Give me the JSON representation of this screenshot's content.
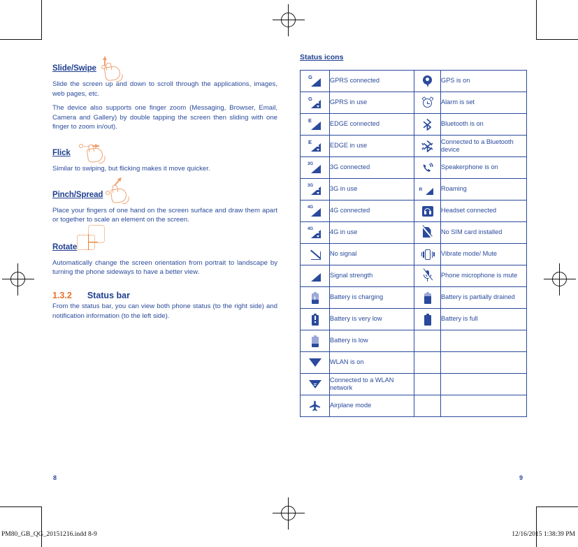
{
  "document": {
    "left_page_number": "8",
    "right_page_number": "9",
    "footer_left": "PM80_GB_QG_20151216.indd   8-9",
    "footer_right": "12/16/2015   1:38:39 PM"
  },
  "colors": {
    "body_blue": "#2a4a9c",
    "heading_blue": "#1f3f8f",
    "accent_orange": "#e8712a",
    "pictogram_orange": "#f0a070"
  },
  "gestures": [
    {
      "id": "slide-swipe",
      "heading": "Slide/Swipe",
      "icon": "hand-swipe-icon",
      "paragraphs": [
        "Slide the screen up and down to scroll through the applications, images, web pages, etc.",
        "The device also supports one finger zoom (Messaging, Browser, Email, Camera and Gallery) by double tapping the screen then sliding with one finger to zoom in/out)."
      ]
    },
    {
      "id": "flick",
      "heading": "Flick",
      "icon": "hand-flick-icon",
      "paragraphs": [
        "Similar to swiping, but flicking makes it move quicker."
      ]
    },
    {
      "id": "pinch-spread",
      "heading": "Pinch/Spread",
      "icon": "hand-pinch-icon",
      "paragraphs": [
        "Place your fingers of one hand on the screen surface and draw them apart or together to scale an element on the screen."
      ]
    },
    {
      "id": "rotate",
      "heading": "Rotate",
      "icon": "device-rotate-icon",
      "paragraphs": [
        "Automatically change the screen orientation from portrait to landscape by turning the phone sideways to have a better view."
      ]
    }
  ],
  "section": {
    "number": "1.3.2",
    "title": "Status bar",
    "body": "From the status bar, you can view both phone status (to the right side) and notification information (to the left side)."
  },
  "status_icons": {
    "heading": "Status icons",
    "rows": [
      {
        "left_icon": "gprs-connected-icon",
        "left_label": "GPRS connected",
        "right_icon": "gps-icon",
        "right_label": "GPS is on"
      },
      {
        "left_icon": "gprs-in-use-icon",
        "left_label": "GPRS in use",
        "right_icon": "alarm-icon",
        "right_label": "Alarm is set"
      },
      {
        "left_icon": "edge-connected-icon",
        "left_label": "EDGE connected",
        "right_icon": "bluetooth-icon",
        "right_label": "Bluetooth is on"
      },
      {
        "left_icon": "edge-in-use-icon",
        "left_label": "EDGE in use",
        "right_icon": "bluetooth-connected-icon",
        "right_label": "Connected to a Bluetooth device"
      },
      {
        "left_icon": "3g-connected-icon",
        "left_label": "3G connected",
        "right_icon": "speakerphone-icon",
        "right_label": "Speakerphone is on"
      },
      {
        "left_icon": "3g-in-use-icon",
        "left_label": "3G in use",
        "right_icon": "roaming-icon",
        "right_label": "Roaming"
      },
      {
        "left_icon": "4g-connected-icon",
        "left_label": "4G connected",
        "right_icon": "headset-icon",
        "right_label": "Headset connected"
      },
      {
        "left_icon": "4g-in-use-icon",
        "left_label": "4G in use",
        "right_icon": "no-sim-card-icon",
        "right_label": "No SIM card installed"
      },
      {
        "left_icon": "no-signal-icon",
        "left_label": "No signal",
        "right_icon": "vibrate-icon",
        "right_label": "Vibrate mode/ Mute"
      },
      {
        "left_icon": "signal-strength-icon",
        "left_label": "Signal strength",
        "right_icon": "microphone-mute-icon",
        "right_label": "Phone microphone is mute"
      },
      {
        "left_icon": "battery-charging-icon",
        "left_label": "Battery is charging",
        "right_icon": "battery-partial-icon",
        "right_label": "Battery is partially drained"
      },
      {
        "left_icon": "battery-very-low-icon",
        "left_label": "Battery is very low",
        "right_icon": "battery-full-icon",
        "right_label": "Battery is full"
      },
      {
        "left_icon": "battery-low-icon",
        "left_label": "Battery is low",
        "right_icon": "",
        "right_label": ""
      },
      {
        "left_icon": "wlan-on-icon",
        "left_label": "WLAN is on",
        "right_icon": "",
        "right_label": ""
      },
      {
        "left_icon": "wlan-connected-icon",
        "left_label": "Connected to a WLAN network",
        "right_icon": "",
        "right_label": ""
      },
      {
        "left_icon": "airplane-mode-icon",
        "left_label": "Airplane mode",
        "right_icon": "",
        "right_label": ""
      }
    ]
  }
}
